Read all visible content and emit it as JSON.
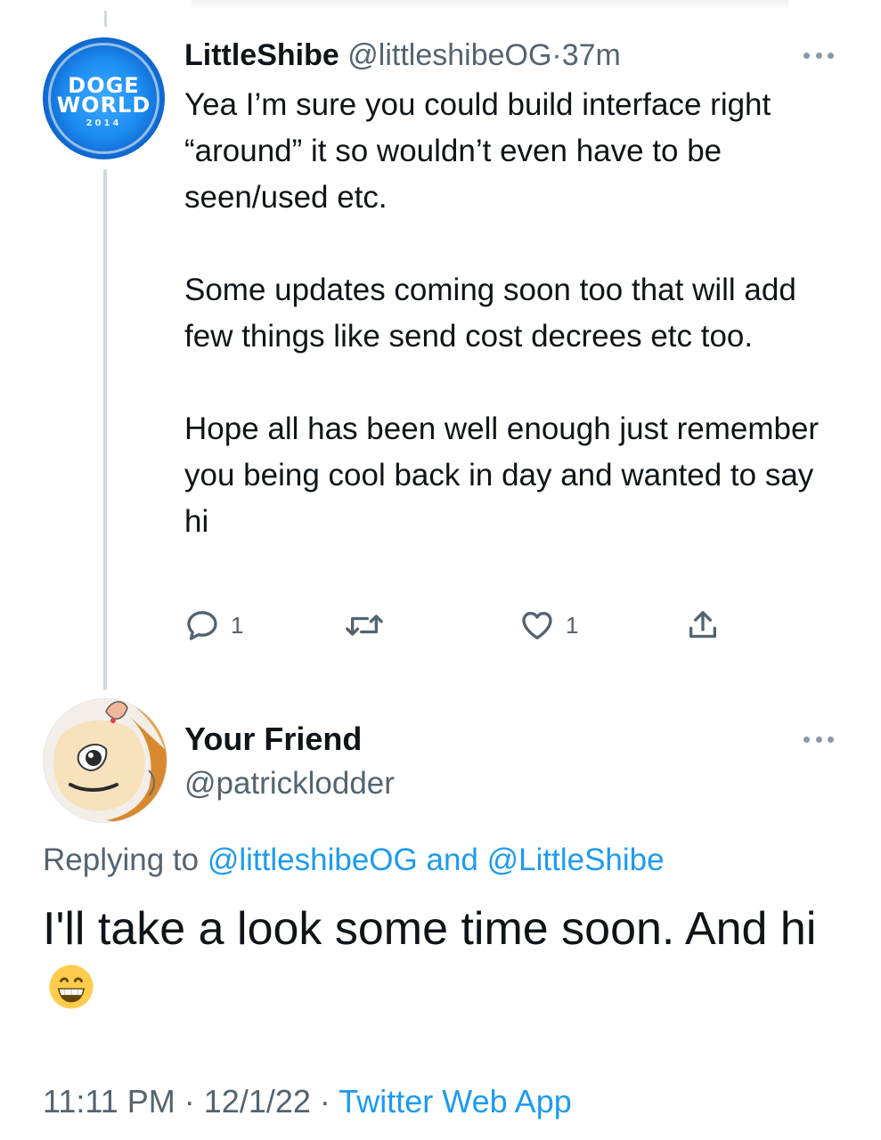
{
  "tweet1": {
    "author_name": "LittleShibe",
    "author_handle": "@littleshibeOG",
    "separator": "·",
    "time": "37m",
    "avatar": {
      "line1": "DOGE",
      "line2": "WORLD",
      "line3": "2014"
    },
    "body": [
      "Yea I’m sure you could build interface right “around” it so wouldn’t even have to be seen/used etc.",
      "Some updates coming soon too that will add few things like send cost decrees etc too.",
      "Hope all has been well enough just remember you being cool back in day and wanted to say hi"
    ],
    "actions": {
      "reply_count": "1",
      "like_count": "1"
    }
  },
  "tweet2": {
    "author_name": "Your Friend",
    "author_handle": "@patricklodder",
    "replying_prefix": "Replying to",
    "replying_handle_1": "@littleshibeOG",
    "replying_and": "and",
    "replying_handle_2": "@LittleShibe",
    "body_text": "I'll take a look some time soon. And hi",
    "emoji": "grinning-face-with-smiling-eyes",
    "time": "11:11 PM",
    "date": "12/1/22",
    "separator": "·",
    "source": "Twitter Web App"
  },
  "colors": {
    "text": "#0f1419",
    "muted": "#536471",
    "link": "#1d9bf0",
    "thread_line": "#cfd9de"
  },
  "icons": [
    "reply-icon",
    "retweet-icon",
    "like-icon",
    "share-icon",
    "more-icon"
  ]
}
